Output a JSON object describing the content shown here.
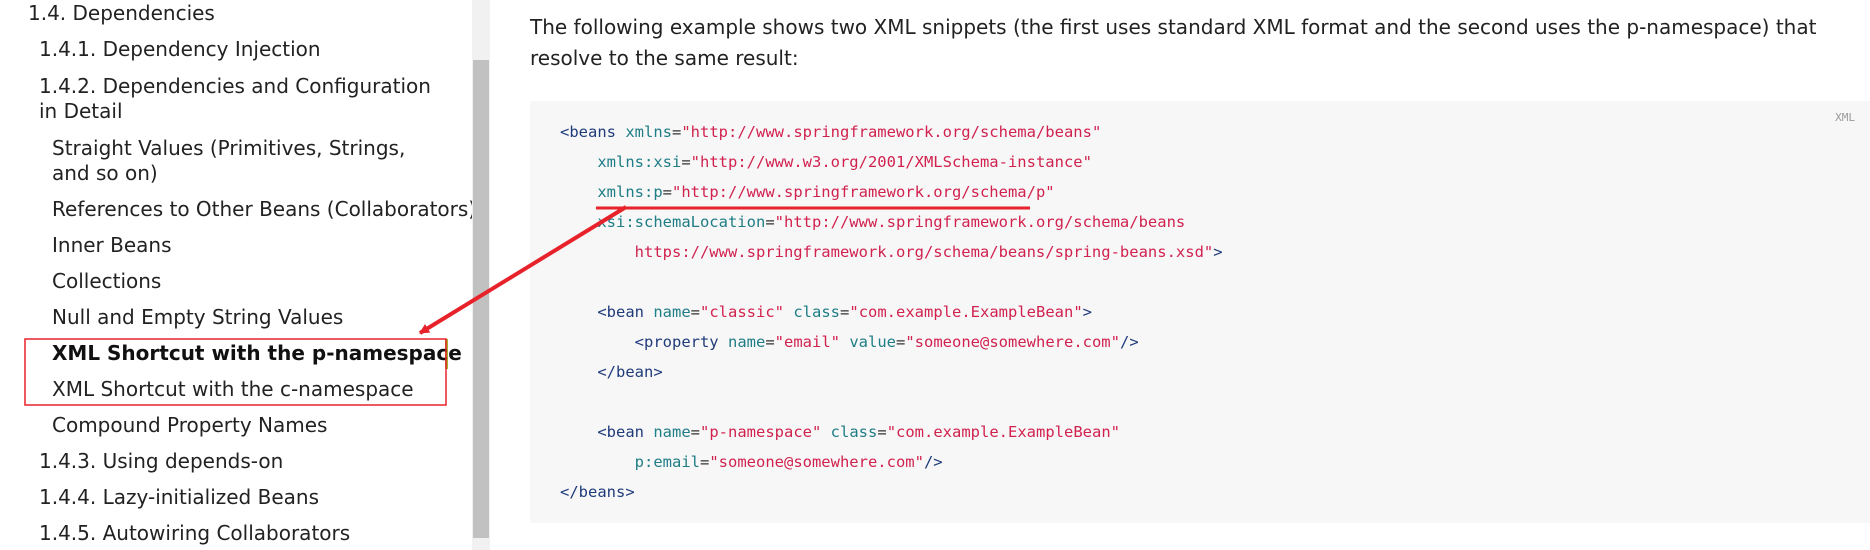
{
  "sidebar": {
    "items": [
      {
        "label": "1.4. Dependencies"
      },
      {
        "label": "1.4.1. Dependency Injection"
      },
      {
        "label": "1.4.2. Dependencies and Configuration in Detail"
      },
      {
        "label": "Straight Values (Primitives, Strings, and so on)"
      },
      {
        "label": "References to Other Beans (Collaborators)"
      },
      {
        "label": "Inner Beans"
      },
      {
        "label": "Collections"
      },
      {
        "label": "Null and Empty String Values"
      },
      {
        "label": "XML Shortcut with the p-namespace"
      },
      {
        "label": "XML Shortcut with the c-namespace"
      },
      {
        "label": "Compound Property Names"
      },
      {
        "label": "1.4.3. Using depends-on"
      },
      {
        "label": "1.4.4. Lazy-initialized Beans"
      },
      {
        "label": "1.4.5. Autowiring Collaborators"
      }
    ]
  },
  "main": {
    "intro_text": "The following example shows two XML snippets (the first uses standard XML format and the second uses the p-namespace) that resolve to the same result:",
    "code_language": "XML",
    "code": {
      "l1": {
        "a": "<beans",
        "b": " xmlns",
        "c": "=",
        "d": "\"http://www.springframework.org/schema/beans\""
      },
      "l2": {
        "b": "xmlns:xsi",
        "c": "=",
        "d": "\"http://www.w3.org/2001/XMLSchema-instance\""
      },
      "l3": {
        "b": "xmlns:p",
        "c": "=",
        "d": "\"http://www.springframework.org/schema/p\""
      },
      "l4": {
        "b": "xsi:schemaLocation",
        "c": "=",
        "d": "\"http://www.springframework.org/schema/beans"
      },
      "l5": {
        "d": "https://www.springframework.org/schema/beans/spring-beans.xsd\"",
        "e": ">"
      },
      "l6": {
        "a": "<bean",
        "b1": " name",
        "c1": "=",
        "d1": "\"classic\"",
        "b2": " class",
        "c2": "=",
        "d2": "\"com.example.ExampleBean\"",
        "e": ">"
      },
      "l7": {
        "a": "<property",
        "b1": " name",
        "c1": "=",
        "d1": "\"email\"",
        "b2": " value",
        "c2": "=",
        "d2": "\"someone@somewhere.com\"",
        "e": "/>"
      },
      "l8": {
        "a": "</bean>"
      },
      "l9": {
        "a": "<bean",
        "b1": " name",
        "c1": "=",
        "d1": "\"p-namespace\"",
        "b2": " class",
        "c2": "=",
        "d2": "\"com.example.ExampleBean\""
      },
      "l10": {
        "b": "p:email",
        "c": "=",
        "d": "\"someone@somewhere.com\"",
        "e": "/>"
      },
      "l11": {
        "a": "</beans>"
      }
    }
  },
  "colors": {
    "annotation_red": "#e8222a",
    "tag": "#1f3b7a",
    "attribute": "#1e7d85",
    "string": "#d1224e",
    "active_marker": "#a3b130"
  }
}
